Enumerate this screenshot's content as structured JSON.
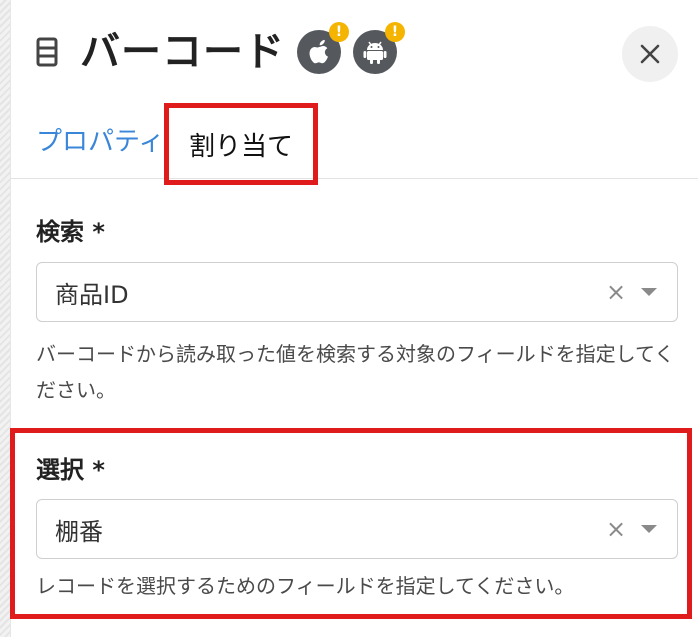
{
  "header": {
    "title": "バーコード",
    "doc_icon": "document-icon",
    "platform_badges": [
      {
        "platform": "apple",
        "icon": "apple-icon",
        "warning": "!"
      },
      {
        "platform": "android",
        "icon": "android-icon",
        "warning": "!"
      }
    ],
    "close_icon": "close-icon"
  },
  "tabs": [
    {
      "label": "プロパティ",
      "active": false
    },
    {
      "label": "割り当て",
      "active": true
    }
  ],
  "search_field": {
    "label": "検索 *",
    "value": "商品ID",
    "clear": "×",
    "help": "バーコードから読み取った値を検索する対象のフィールドを指定してください。"
  },
  "select_field": {
    "label": "選択 *",
    "value": "棚番",
    "clear": "×",
    "help": "レコードを選択するためのフィールドを指定してください。"
  },
  "colors": {
    "accent": "#3a86d8",
    "highlight": "#e01b1b",
    "warning": "#f4b400",
    "badge": "#55595e"
  }
}
